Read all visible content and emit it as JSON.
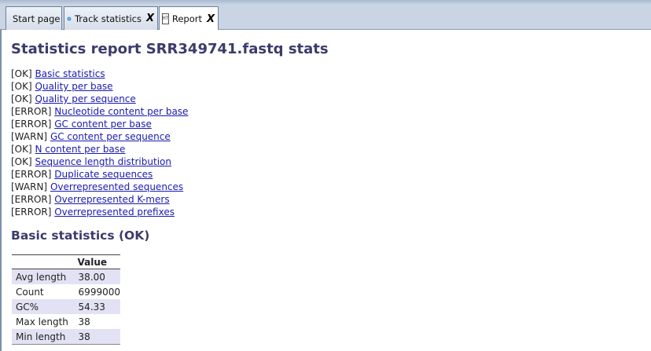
{
  "tabs": [
    {
      "label": "Start page",
      "closable": false,
      "active": false
    },
    {
      "label": "Track statistics",
      "icon": "gear-icon",
      "closable": true,
      "close": "X",
      "active": false
    },
    {
      "label": "Report",
      "icon": "html-file-icon",
      "icon_text": "HTML",
      "closable": true,
      "close": "X",
      "active": true
    }
  ],
  "report": {
    "title": "Statistics report SRR349741.fastq stats",
    "modules": [
      {
        "status": "[OK]",
        "name": "Basic statistics"
      },
      {
        "status": "[OK]",
        "name": "Quality per base"
      },
      {
        "status": "[OK]",
        "name": "Quality per sequence"
      },
      {
        "status": "[ERROR]",
        "name": "Nucleotide content per base"
      },
      {
        "status": "[ERROR]",
        "name": "GC content per base"
      },
      {
        "status": "[WARN]",
        "name": "GC content per sequence"
      },
      {
        "status": "[OK]",
        "name": "N content per base"
      },
      {
        "status": "[OK]",
        "name": "Sequence length distribution"
      },
      {
        "status": "[ERROR]",
        "name": "Duplicate sequences"
      },
      {
        "status": "[WARN]",
        "name": "Overrepresented sequences"
      },
      {
        "status": "[ERROR]",
        "name": "Overrepresented K-mers"
      },
      {
        "status": "[ERROR]",
        "name": "Overrepresented prefixes"
      }
    ],
    "basic_stats": {
      "heading": "Basic statistics (OK)",
      "columns": [
        "",
        "Value"
      ],
      "rows": [
        {
          "label": "Avg length",
          "value": "38.00"
        },
        {
          "label": "Count",
          "value": "6999000"
        },
        {
          "label": "GC%",
          "value": "54.33"
        },
        {
          "label": "Max length",
          "value": "38"
        },
        {
          "label": "Min length",
          "value": "38"
        }
      ]
    }
  },
  "colors": {
    "heading": "#3b3b6b",
    "link": "#1a1ab0",
    "row_alt": "#e2e2f4",
    "tab_strip": "#c9d4e4"
  }
}
